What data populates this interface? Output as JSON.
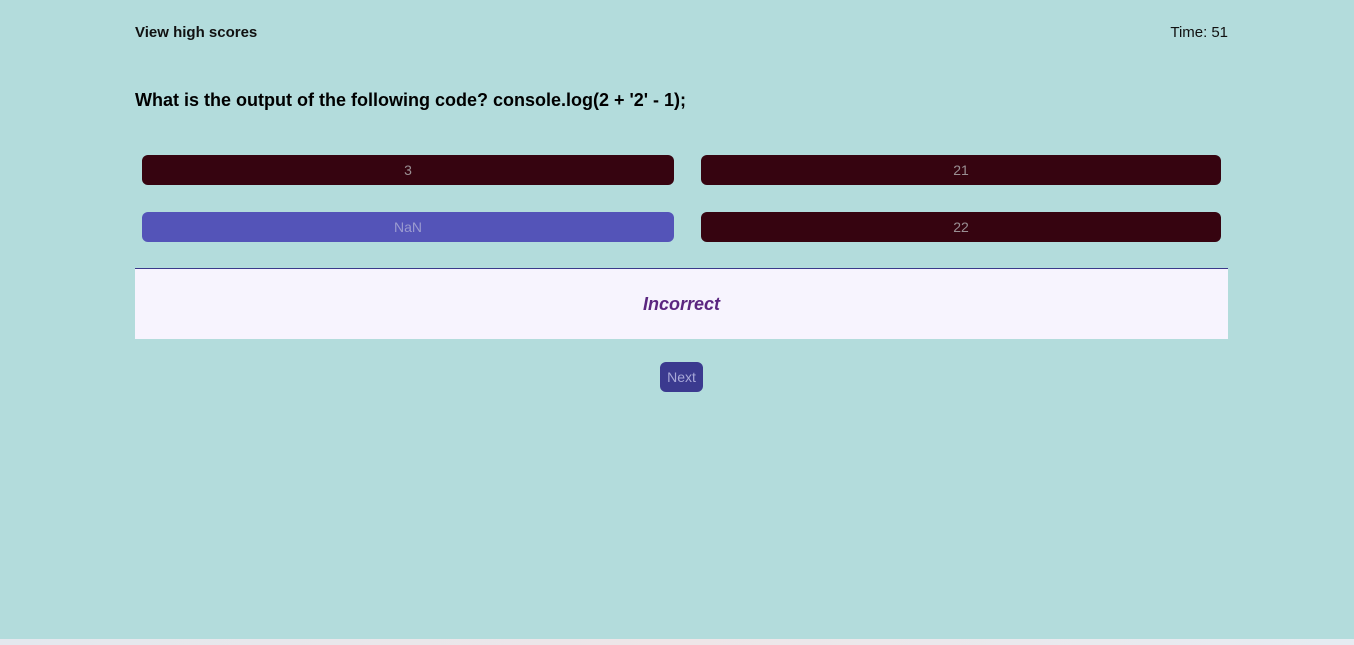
{
  "header": {
    "high_scores_label": "View high scores",
    "timer_label": "Time:",
    "timer_value": "51"
  },
  "quiz": {
    "question": "What is the output of the following code? console.log(2 + '2' - 1);",
    "choices": [
      {
        "label": "3",
        "selected": false
      },
      {
        "label": "21",
        "selected": false
      },
      {
        "label": "NaN",
        "selected": true
      },
      {
        "label": "22",
        "selected": false
      }
    ],
    "feedback": "Incorrect",
    "next_label": "Next"
  },
  "colors": {
    "background": "#b3dcdc",
    "choice_dark": "#360410",
    "choice_selected": "#5454b8",
    "feedback_bg": "#f7f4fe",
    "feedback_text": "#5b2680",
    "next_button": "#3b3a8f"
  }
}
